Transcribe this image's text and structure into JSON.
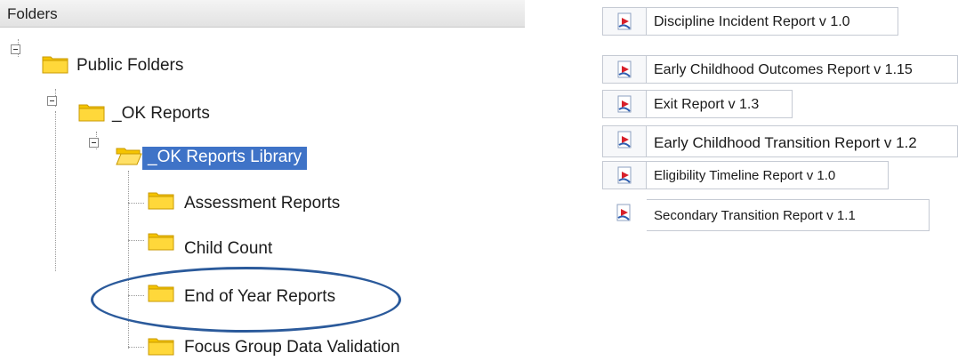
{
  "folders_panel": {
    "header": "Folders",
    "nodes": [
      {
        "label": "Public Folders"
      },
      {
        "label": "_OK Reports"
      },
      {
        "label": "_OK Reports Library"
      },
      {
        "label": "Assessment Reports"
      },
      {
        "label": "Child Count"
      },
      {
        "label": "End of Year Reports"
      },
      {
        "label": "Focus Group Data Validation"
      }
    ],
    "selected": "_OK Reports Library",
    "circled": "End of Year Reports"
  },
  "reports": [
    {
      "label": "Discipline Incident Report v 1.0",
      "icon": "report-icon"
    },
    {
      "label": "Early Childhood Outcomes Report v 1.15",
      "icon": "report-icon"
    },
    {
      "label": "Exit Report v 1.3",
      "icon": "report-icon"
    },
    {
      "label": "Early Childhood Transition Report v 1.2",
      "icon": "report-icon"
    },
    {
      "label": "Eligibility Timeline Report v 1.0",
      "icon": "report-icon"
    },
    {
      "label": "Secondary Transition Report v 1.1",
      "icon": "report-icon"
    }
  ],
  "colors": {
    "selection": "#3f73c7",
    "circle": "#2b5a9b",
    "folder": "#f5c400"
  }
}
